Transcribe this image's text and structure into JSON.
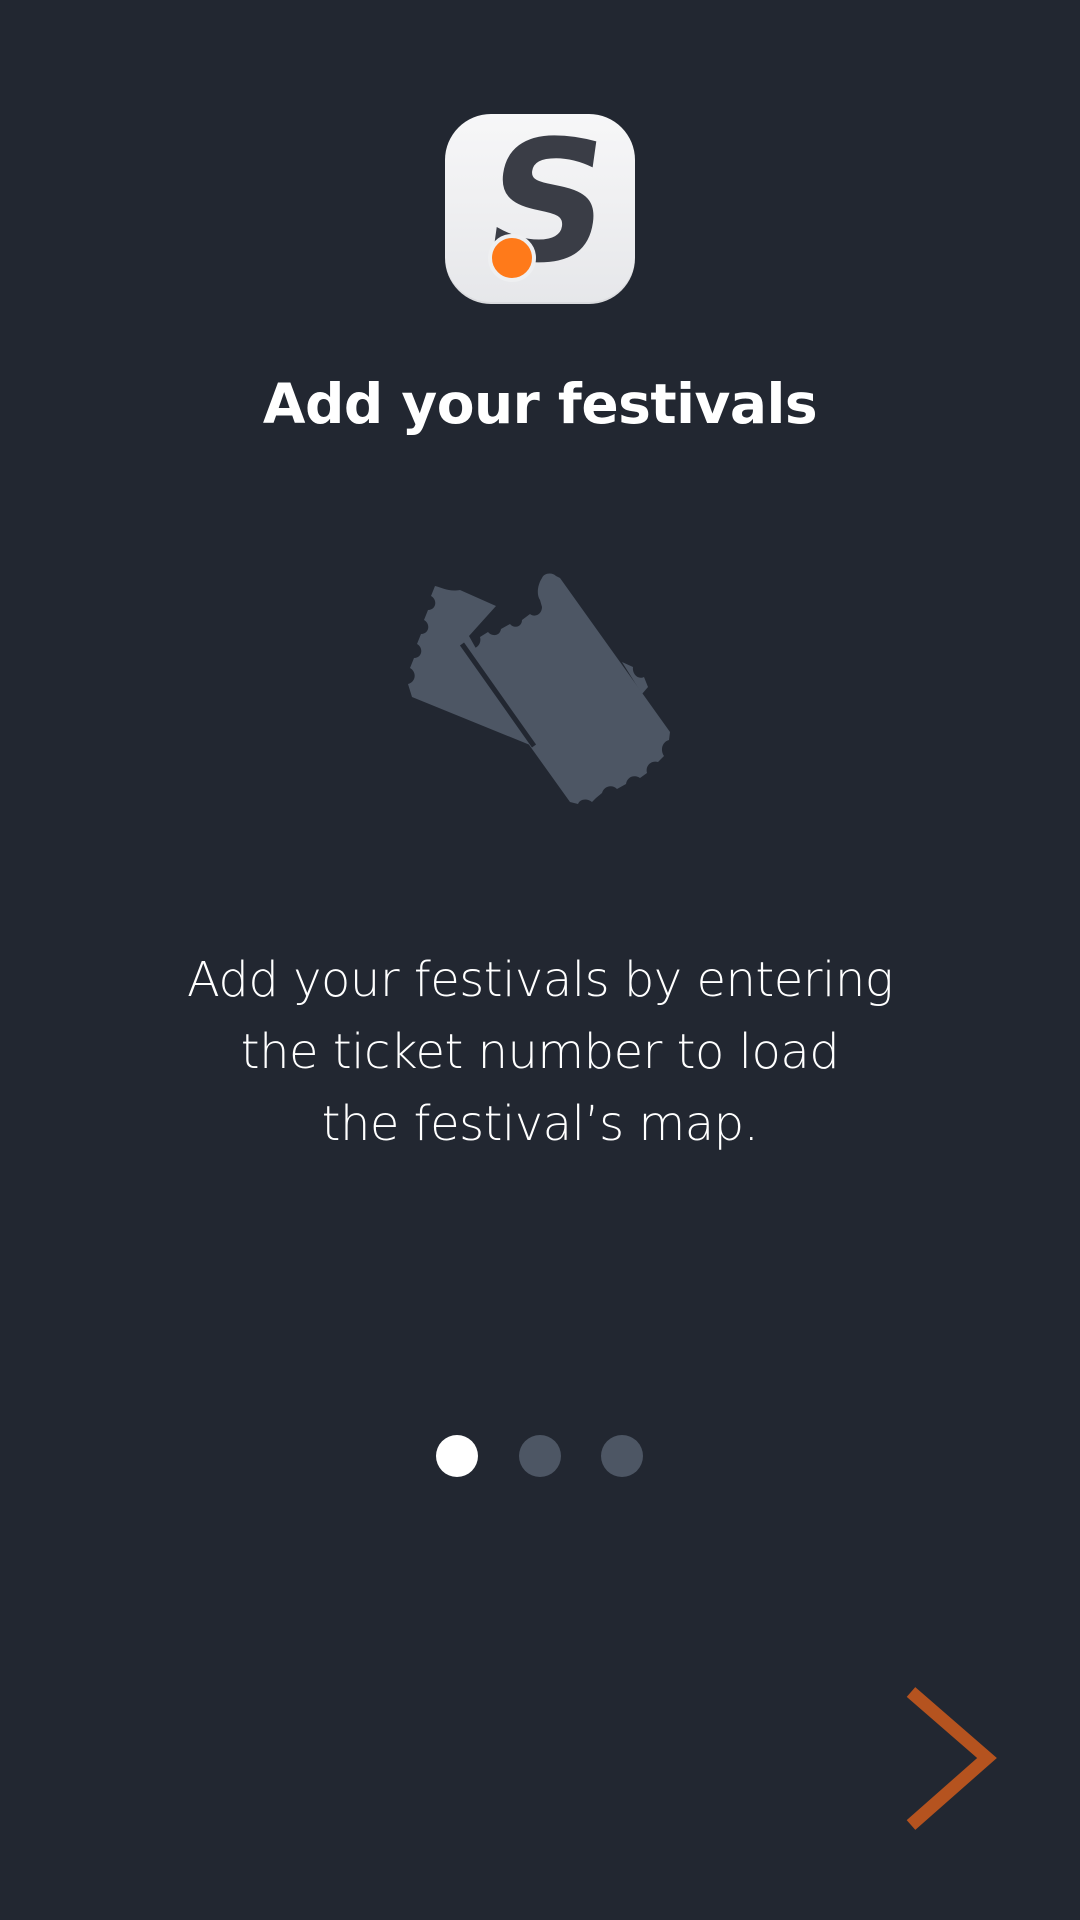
{
  "onboarding": {
    "logo": {
      "letter": "S",
      "letter_color": "#3a3d46",
      "dot_color": "#ff7a1a",
      "background_color": "#eeeff1"
    },
    "title": "Add your festivals",
    "illustration_icon": "ticket-icon",
    "description_lines": [
      "Add your festivals by entering",
      "the ticket number to load",
      "the festival’s map."
    ],
    "pager": {
      "total": 3,
      "active_index": 0
    },
    "next_icon": "chevron-right-icon"
  },
  "colors": {
    "background": "#222731",
    "text": "#ffffff",
    "illustration": "#4d5664",
    "pager_inactive": "#4d5664",
    "pager_active": "#ffffff",
    "accent": "#b5531f"
  }
}
